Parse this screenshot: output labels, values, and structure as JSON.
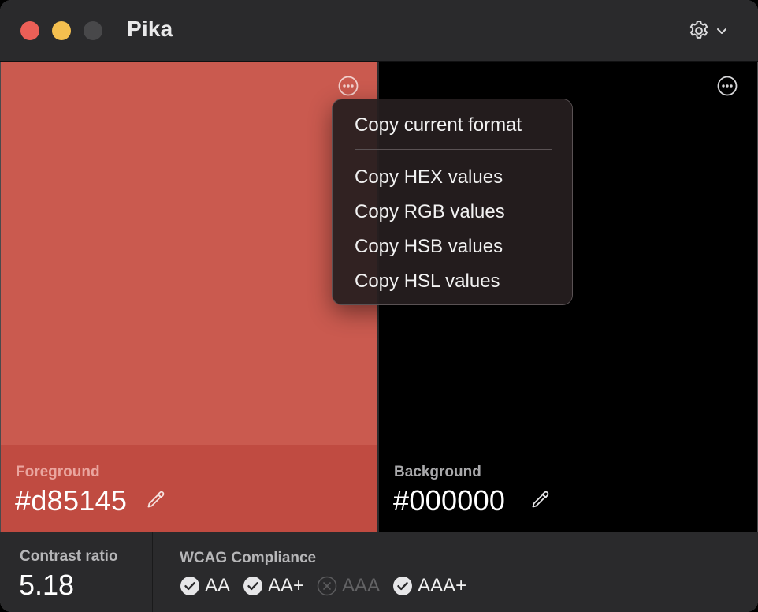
{
  "window": {
    "title": "Pika"
  },
  "toolbar": {
    "settings_icon": "gear-icon",
    "settings_chevron": "chevron-down-icon"
  },
  "foreground": {
    "label": "Foreground",
    "value": "#d85145",
    "color": "#ca5a4f"
  },
  "background": {
    "label": "Background",
    "value": "#000000",
    "color": "#000000"
  },
  "context_menu": {
    "primary": "Copy current format",
    "items": [
      "Copy HEX values",
      "Copy RGB values",
      "Copy HSB values",
      "Copy HSL values"
    ]
  },
  "contrast": {
    "label": "Contrast ratio",
    "value": "5.18"
  },
  "wcag": {
    "label": "WCAG Compliance",
    "badges": [
      {
        "label": "AA",
        "status": "pass"
      },
      {
        "label": "AA+",
        "status": "pass"
      },
      {
        "label": "AAA",
        "status": "fail"
      },
      {
        "label": "AAA+",
        "status": "pass"
      }
    ]
  }
}
